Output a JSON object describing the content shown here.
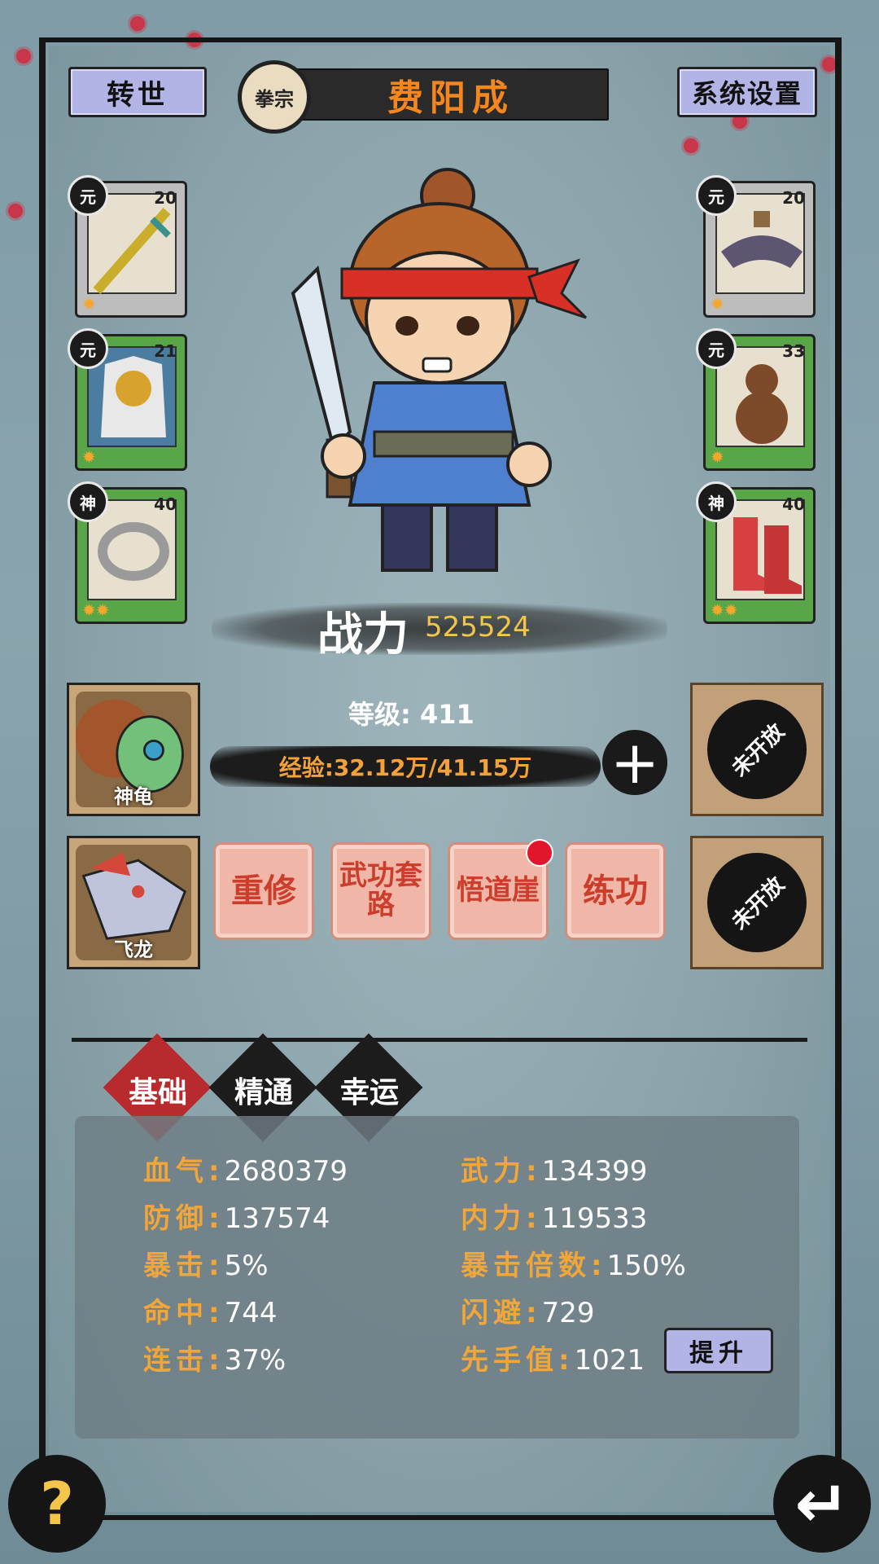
{
  "header": {
    "rebirth_label": "转世",
    "sect_badge": "拳宗",
    "player_name": "费阳成",
    "settings_label": "系统设置"
  },
  "equipment": {
    "left": [
      {
        "grade": "元",
        "level": "20",
        "stars": "✹",
        "item": "sword-icon"
      },
      {
        "grade": "元",
        "level": "21",
        "stars": "✹",
        "item": "armor-icon"
      },
      {
        "grade": "神",
        "level": "40",
        "stars": "✹✹",
        "item": "ring-icon"
      }
    ],
    "right": [
      {
        "grade": "元",
        "level": "20",
        "stars": "✹",
        "item": "hat-icon"
      },
      {
        "grade": "元",
        "level": "33",
        "stars": "✹",
        "item": "gourd-icon"
      },
      {
        "grade": "神",
        "level": "40",
        "stars": "✹✹",
        "item": "boots-icon"
      }
    ]
  },
  "power": {
    "label": "战力",
    "value": "525524"
  },
  "level": {
    "text": "等级: 411"
  },
  "exp": {
    "text": "经验:32.12万/41.15万",
    "fraction": 0.78
  },
  "pets": [
    {
      "name": "神龟",
      "icon": "turtle-icon"
    },
    {
      "name": "飞龙",
      "icon": "dragon-icon"
    }
  ],
  "locked_slots": [
    "未开放",
    "未开放"
  ],
  "actions": [
    {
      "label": "重修"
    },
    {
      "label": "武功套路"
    },
    {
      "label": "悟道崖"
    },
    {
      "label": "练功"
    }
  ],
  "tabs": [
    {
      "label": "基础",
      "active": true
    },
    {
      "label": "精通",
      "active": false
    },
    {
      "label": "幸运",
      "active": false
    }
  ],
  "stats": {
    "left": [
      {
        "k": "血气:",
        "v": "2680379"
      },
      {
        "k": "防御:",
        "v": "137574"
      },
      {
        "k": "暴击:",
        "v": "5%"
      },
      {
        "k": "命中:",
        "v": "744"
      },
      {
        "k": "连击:",
        "v": "37%"
      }
    ],
    "right": [
      {
        "k": "武力:",
        "v": "134399"
      },
      {
        "k": "内力:",
        "v": "119533"
      },
      {
        "k": "暴击倍数:",
        "v": "150%"
      },
      {
        "k": "闪避:",
        "v": "729"
      },
      {
        "k": "先手值:",
        "v": "1021"
      }
    ],
    "upgrade_label": "提升"
  },
  "footer": {
    "help_icon": "question-icon",
    "back_icon": "return-arrow-icon",
    "help_glyph": "?",
    "back_glyph": "↵"
  },
  "colors": {
    "accent_orange": "#f1a63a",
    "active_tab": "#b72a2e",
    "power_gold": "#f3c54a"
  }
}
